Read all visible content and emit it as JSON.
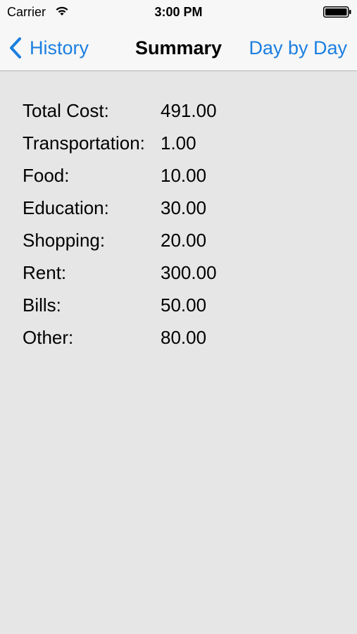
{
  "status_bar": {
    "carrier": "Carrier",
    "time": "3:00 PM",
    "wifi_icon": "wifi-icon",
    "battery_icon": "battery-icon"
  },
  "nav": {
    "back_label": "History",
    "back_icon": "chevron-left-icon",
    "title": "Summary",
    "right_label": "Day by Day",
    "accent_color": "#1b7fe0"
  },
  "summary": {
    "rows": [
      {
        "label": "Total Cost:",
        "value": "491.00"
      },
      {
        "label": "Transportation:",
        "value": "1.00"
      },
      {
        "label": "Food:",
        "value": "10.00"
      },
      {
        "label": "Education:",
        "value": "30.00"
      },
      {
        "label": "Shopping:",
        "value": "20.00"
      },
      {
        "label": "Rent:",
        "value": "300.00"
      },
      {
        "label": "Bills:",
        "value": "50.00"
      },
      {
        "label": "Other:",
        "value": "80.00"
      }
    ]
  },
  "colors": {
    "background": "#e6e6e6",
    "bar_background": "#f7f7f7"
  }
}
